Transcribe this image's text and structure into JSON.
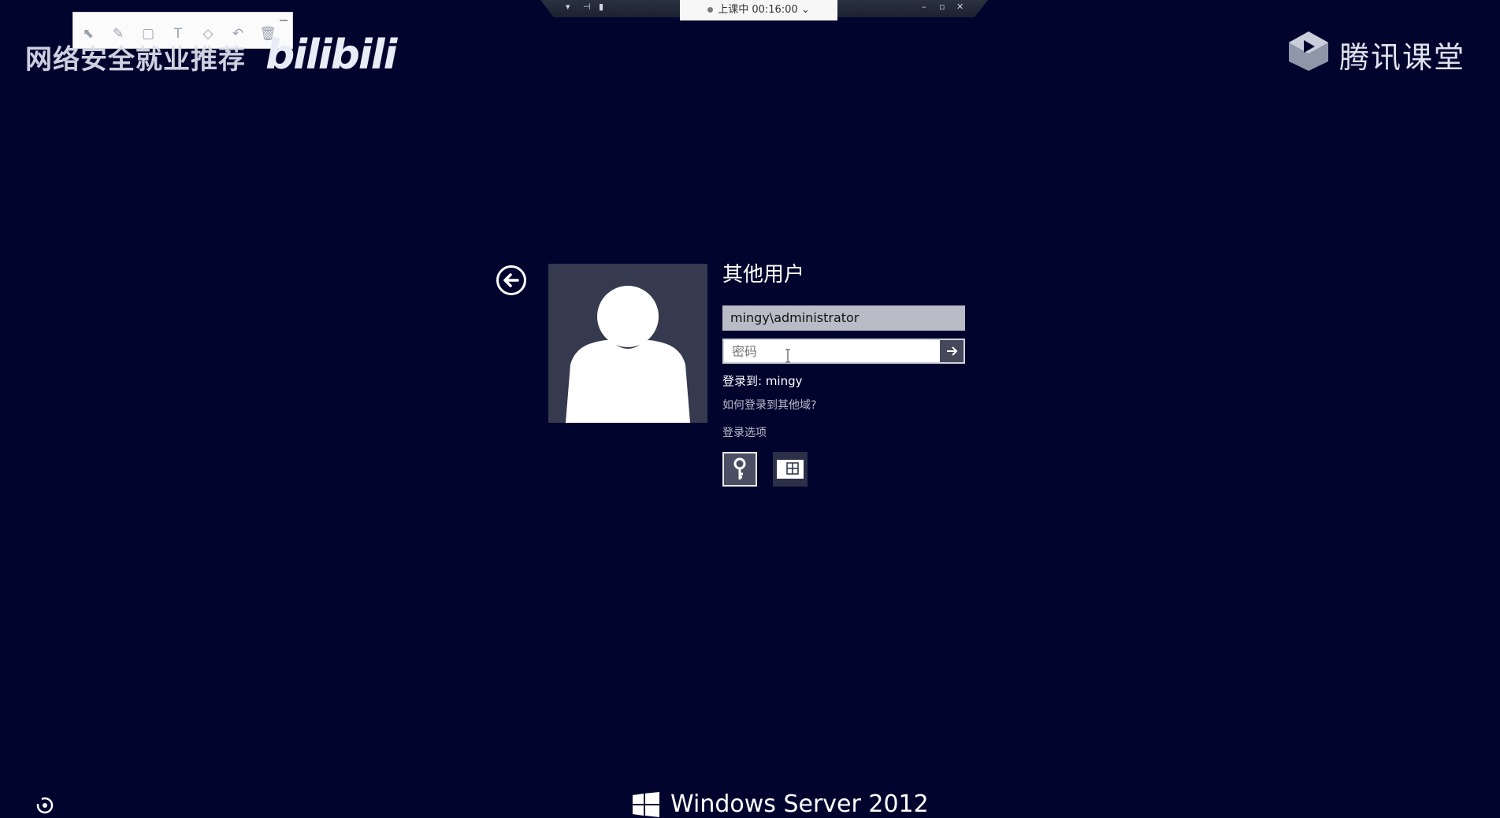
{
  "watermark": {
    "text": "网络安全就业推荐",
    "logo_text": "bilibili"
  },
  "annotation_toolbar": {
    "tools": [
      {
        "name": "select",
        "glyph": "⬉"
      },
      {
        "name": "pen",
        "glyph": "✎"
      },
      {
        "name": "shape",
        "glyph": "▢"
      },
      {
        "name": "text",
        "glyph": "T"
      },
      {
        "name": "eraser",
        "glyph": "◇"
      },
      {
        "name": "undo",
        "glyph": "↶"
      },
      {
        "name": "delete",
        "glyph": "🗑"
      }
    ]
  },
  "meeting": {
    "status": "上课中 00:16:00",
    "chevron": "⌄"
  },
  "brand": {
    "name": "腾讯课堂"
  },
  "login": {
    "title": "其他用户",
    "username": "mingy\\administrator",
    "password_placeholder": "密码",
    "sign_in_to": "登录到: mingy",
    "how_link": "如何登录到其他域?",
    "options_link": "登录选项"
  },
  "footer": {
    "os_name": "Windows Server 2012"
  },
  "colors": {
    "background": "#01052e",
    "avatar_bg": "#353a4f",
    "field_bg": "#b9bcc6"
  }
}
